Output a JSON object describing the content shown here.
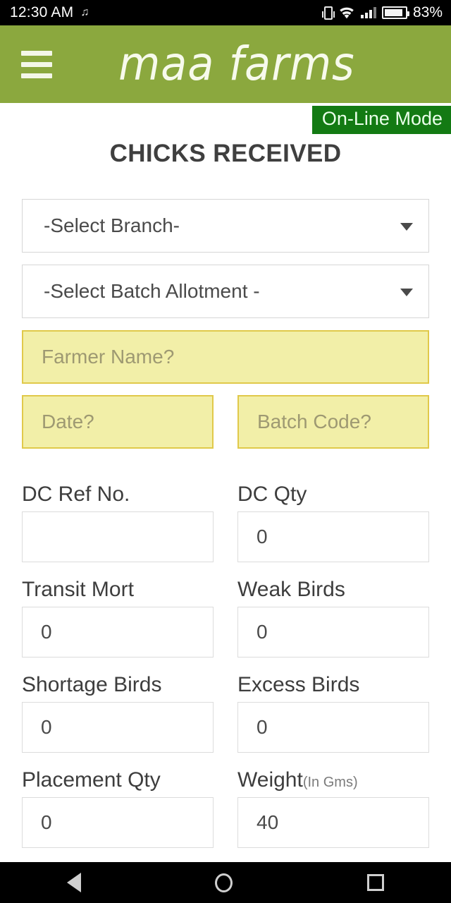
{
  "status_bar": {
    "time": "12:30 AM",
    "music_icon": "music-note-icon",
    "vibrate_icon": "vibrate-icon",
    "wifi_icon": "wifi-icon",
    "signal_icon": "signal-bars-icon",
    "battery_icon": "battery-icon",
    "battery_percent": "83%"
  },
  "header": {
    "menu_icon": "hamburger-menu-icon",
    "brand": "maa farms",
    "brand_color": "#8ba83e"
  },
  "status_badge": {
    "label": "On-Line Mode",
    "color": "#137a13"
  },
  "page_title": "CHICKS RECEIVED",
  "selects": [
    {
      "name": "branch",
      "value": "-Select Branch-",
      "caret_icon": "chevron-down-icon"
    },
    {
      "name": "batch-allotment",
      "value": "-Select Batch Allotment -",
      "caret_icon": "chevron-down-icon"
    }
  ],
  "highlighted_fields": {
    "farmer_name": {
      "placeholder": "Farmer Name?",
      "value": ""
    },
    "date": {
      "placeholder": "Date?",
      "value": ""
    },
    "batch_code": {
      "placeholder": "Batch Code?",
      "value": ""
    },
    "fill_color": "#f2efa8",
    "border_color": "#e0c94a"
  },
  "number_fields": [
    [
      {
        "label": "DC Ref No.",
        "label_sub": "",
        "value": ""
      },
      {
        "label": "DC Qty",
        "label_sub": "",
        "value": "0"
      }
    ],
    [
      {
        "label": "Transit Mort",
        "label_sub": "",
        "value": "0"
      },
      {
        "label": "Weak Birds",
        "label_sub": "",
        "value": "0"
      }
    ],
    [
      {
        "label": "Shortage Birds",
        "label_sub": "",
        "value": "0"
      },
      {
        "label": "Excess Birds",
        "label_sub": "",
        "value": "0"
      }
    ],
    [
      {
        "label": "Placement Qty",
        "label_sub": "",
        "value": "0"
      },
      {
        "label": "Weight",
        "label_sub": "(In Gms)",
        "value": "40"
      }
    ]
  ],
  "nav_bar": {
    "back_icon": "back-triangle-icon",
    "home_icon": "home-circle-icon",
    "recents_icon": "recents-square-icon"
  }
}
